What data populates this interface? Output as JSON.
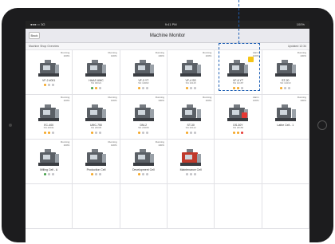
{
  "status_bar": {
    "left": "●●●○○ 3G",
    "time": "9:41 PM",
    "right": "100%"
  },
  "nav": {
    "back_label": "Back",
    "title": "Machine Monitor"
  },
  "section": {
    "left": "Machine Shop Overview",
    "right": "Updated 12:34"
  },
  "status_colors": {
    "running": "#43a047",
    "idle": "#f5a623",
    "stopped": "#e53935",
    "off": "#c2c2c6"
  },
  "tiles": [
    {
      "status": "Running\n100%",
      "name": "VF-2 #001",
      "sub": "",
      "dots": [
        "idle",
        "off",
        "off"
      ],
      "kind": "mill"
    },
    {
      "status": "Running\n100%",
      "name": "HAAS UMC",
      "sub": "SN 00021",
      "dots": [
        "running",
        "idle",
        "off"
      ],
      "kind": "mill"
    },
    {
      "status": "Running\n100%",
      "name": "VF-3 YT",
      "sub": "SN 10082",
      "dots": [
        "idle",
        "off",
        "off"
      ],
      "kind": "mill"
    },
    {
      "status": "Running\n100%",
      "name": "VF-4 SS",
      "sub": "SN 10115",
      "dots": [
        "idle",
        "off",
        "off"
      ],
      "kind": "mill"
    },
    {
      "status": "Alarm\n100%",
      "name": "VF-6 YT",
      "sub": "SN 10187",
      "dots": [
        "idle",
        "idle",
        "off"
      ],
      "kind": "mill",
      "warning": true
    },
    {
      "status": "Running\n100%",
      "name": "ST-20",
      "sub": "SN 10233",
      "dots": [
        "idle",
        "off",
        "off"
      ],
      "kind": "mill"
    },
    {
      "status": "Running\n100%",
      "name": "EC-400",
      "sub": "SN 20011",
      "dots": [
        "idle",
        "idle",
        "off"
      ],
      "kind": "mill"
    },
    {
      "status": "Running\n100%",
      "name": "UMC-750",
      "sub": "SN 20045",
      "dots": [
        "idle",
        "off",
        "off"
      ],
      "kind": "mill"
    },
    {
      "status": "Running\n100%",
      "name": "DM-2",
      "sub": "SN 20098",
      "dots": [
        "idle",
        "off",
        "off"
      ],
      "kind": "mill"
    },
    {
      "status": "Running\n100%",
      "name": "ST-30",
      "sub": "SN 20112",
      "dots": [
        "idle",
        "off",
        "off"
      ],
      "kind": "lathe"
    },
    {
      "status": "Alarm\n100%",
      "name": "DS-30Y",
      "sub": "SN 20156",
      "dots": [
        "idle",
        "idle",
        "stopped"
      ],
      "kind": "mill",
      "alarm": true
    },
    {
      "status": "Running\n100%",
      "name": "Lathe Cell - 1",
      "sub": "",
      "dots": [],
      "kind": "lathe"
    },
    {
      "status": "Running\n100%",
      "name": "Milling Cell - A",
      "sub": "",
      "dots": [
        "running",
        "off",
        "off"
      ],
      "kind": "mill"
    },
    {
      "status": "Running\n100%",
      "name": "Production Cell",
      "sub": "",
      "dots": [
        "idle",
        "off",
        "off"
      ],
      "kind": "mill"
    },
    {
      "status": "Running\n100%",
      "name": "Development Cell",
      "sub": "",
      "dots": [
        "idle",
        "off",
        "off"
      ],
      "kind": "mill"
    },
    {
      "status": "",
      "name": "Maintenance Cell",
      "sub": "",
      "dots": [
        "off",
        "off",
        "off"
      ],
      "kind": "cell"
    },
    {
      "status": "",
      "name": "",
      "sub": "",
      "dots": [],
      "kind": "empty"
    },
    {
      "status": "",
      "name": "",
      "sub": "",
      "dots": [],
      "kind": "empty"
    },
    {
      "status": "",
      "name": "",
      "sub": "",
      "dots": [],
      "kind": "empty"
    },
    {
      "status": "",
      "name": "",
      "sub": "",
      "dots": [],
      "kind": "empty"
    },
    {
      "status": "",
      "name": "",
      "sub": "",
      "dots": [],
      "kind": "empty"
    },
    {
      "status": "",
      "name": "",
      "sub": "",
      "dots": [],
      "kind": "empty"
    },
    {
      "status": "",
      "name": "",
      "sub": "",
      "dots": [],
      "kind": "empty"
    },
    {
      "status": "",
      "name": "",
      "sub": "",
      "dots": [],
      "kind": "empty"
    }
  ]
}
